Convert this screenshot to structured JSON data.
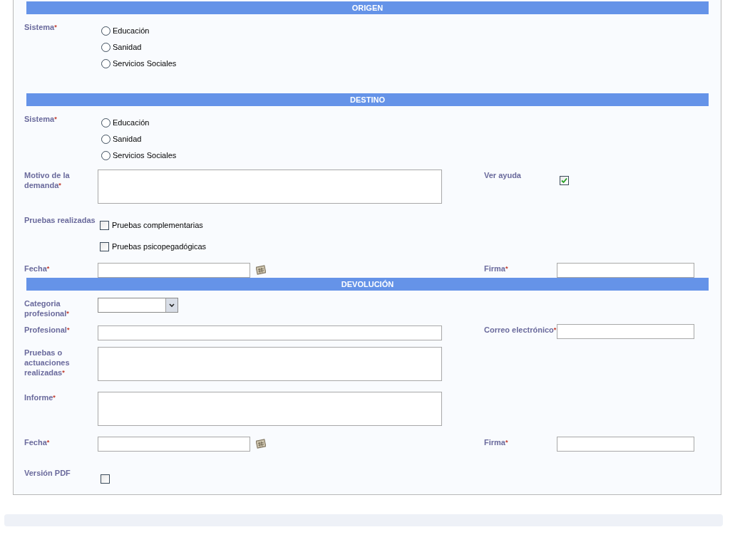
{
  "sections": [
    {
      "title": "ORIGEN",
      "rows": [
        {
          "kind": "radio",
          "label": "Sistema",
          "mark": "*",
          "options": [
            {
              "label": "Educación",
              "selected": false
            },
            {
              "label": "Sanidad",
              "selected": false
            },
            {
              "label": "Servicios Sociales",
              "selected": false
            }
          ]
        }
      ]
    },
    {
      "title": "DESTINO",
      "rows": [
        {
          "kind": "radio",
          "label": "Sistema",
          "mark": "*",
          "options": [
            {
              "label": "Educación",
              "selected": false
            },
            {
              "label": "Sanidad",
              "selected": false
            },
            {
              "label": "Servicios Sociales",
              "selected": false
            }
          ]
        },
        {
          "kind": "textarea",
          "label": "Motivo de la demanda",
          "mark": "*",
          "right": {
            "kind": "checkbox",
            "label": "Ver ayuda",
            "checked": true
          }
        },
        {
          "kind": "checks",
          "label": "Pruebas realizadas",
          "options": [
            {
              "label": "Pruebas complementarias",
              "checked": false
            },
            {
              "label": "Pruebas psicopegadógicas",
              "checked": false
            }
          ]
        },
        {
          "kind": "date",
          "label": "Fecha",
          "mark": "*",
          "right": {
            "kind": "text",
            "label": "Firma",
            "mark": "*"
          }
        }
      ]
    },
    {
      "title": "DEVOLUCIÓN",
      "rows": [
        {
          "kind": "select",
          "label": "Categoria profesional",
          "mark": "*"
        },
        {
          "kind": "text",
          "label": "Profesional",
          "mark": "*",
          "right": {
            "kind": "text",
            "label": "Correo electrónico",
            "mark": "*"
          }
        },
        {
          "kind": "textarea",
          "label": "Pruebas o actuaciones realizadas",
          "mark": "*"
        },
        {
          "kind": "textarea",
          "label": "Informe",
          "mark": "*"
        },
        {
          "kind": "date",
          "label": "Fecha",
          "mark": "*",
          "right": {
            "kind": "text",
            "label": "Firma",
            "mark": "*"
          }
        },
        {
          "kind": "checkbox",
          "label": "Versión PDF",
          "checked": false
        }
      ]
    }
  ]
}
